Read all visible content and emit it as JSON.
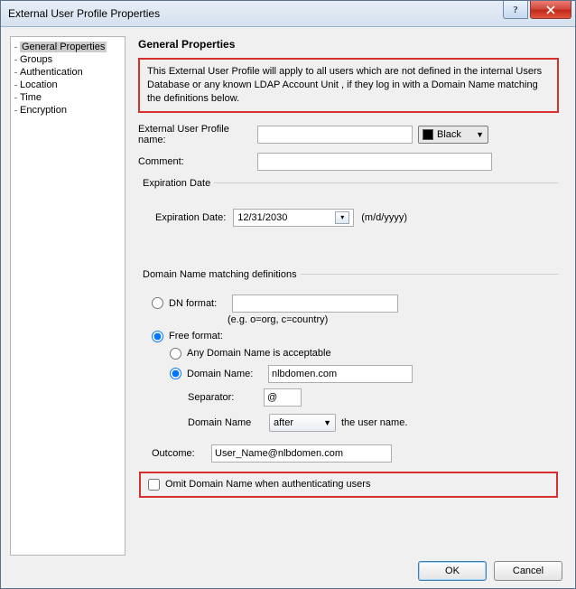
{
  "window": {
    "title": "External User Profile Properties"
  },
  "nav": {
    "items": [
      {
        "label": "General Properties",
        "selected": true
      },
      {
        "label": "Groups"
      },
      {
        "label": "Authentication"
      },
      {
        "label": "Location"
      },
      {
        "label": "Time"
      },
      {
        "label": "Encryption"
      }
    ]
  },
  "page": {
    "heading": "General Properties",
    "info": "This External User Profile will apply to all users which are not defined in the internal Users Database or any known LDAP Account Unit , if they log in with a Domain Name matching the definitions below.",
    "name_label": "External User Profile name:",
    "name_value": "",
    "color_label": "Black",
    "comment_label": "Comment:",
    "comment_value": "",
    "exp_legend": "Expiration Date",
    "exp_label": "Expiration Date:",
    "exp_value": "12/31/2030",
    "exp_hint": "(m/d/yyyy)",
    "dn_legend": "Domain Name matching definitions",
    "dnformat_label": "DN format:",
    "dnformat_value": "",
    "dnformat_hint": "(e.g. o=org, c=country)",
    "freeformat_label": "Free format:",
    "any_label": "Any Domain Name is acceptable",
    "domname_label": "Domain Name:",
    "domname_value": "nlbdomen.com",
    "sep_label": "Separator:",
    "sep_value": "@",
    "pos_label_pre": "Domain Name",
    "pos_value": "after",
    "pos_label_post": "the user name.",
    "outcome_label": "Outcome:",
    "outcome_value": "User_Name@nlbdomen.com",
    "omit_label": "Omit Domain Name when authenticating users"
  },
  "buttons": {
    "ok": "OK",
    "cancel": "Cancel"
  }
}
